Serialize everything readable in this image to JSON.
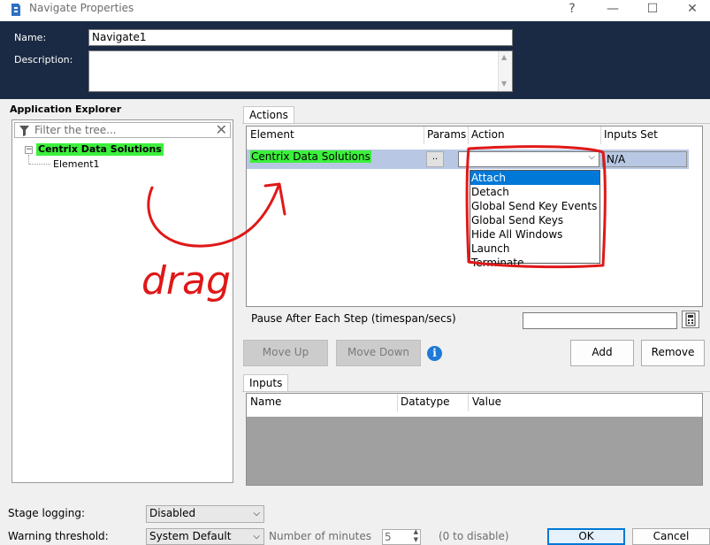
{
  "window": {
    "title": "Navigate Properties",
    "help": "?",
    "minimize": "—",
    "maximize": "☐",
    "close": "✕"
  },
  "header": {
    "name_label": "Name:",
    "name_value": "Navigate1",
    "description_label": "Description:"
  },
  "explorer": {
    "title": "Application Explorer",
    "filter_placeholder": "Filter the tree...",
    "root": "Centrix Data Solutions",
    "child": "Element1",
    "expander": "−"
  },
  "actions": {
    "tab_label": "Actions",
    "columns": [
      "Element",
      "Params",
      "Action",
      "Inputs Set"
    ],
    "row": {
      "element": "Centrix Data Solutions",
      "params": "..",
      "action": "",
      "inputs_set": "N/A"
    },
    "dropdown_items": [
      "Attach",
      "Detach",
      "Global Send Key Events",
      "Global Send Keys",
      "Hide All Windows",
      "Launch",
      "Terminate"
    ],
    "selected_index": 0,
    "pause_label": "Pause After Each Step (timespan/secs)"
  },
  "buttons": {
    "move_up": "Move Up",
    "move_down": "Move Down",
    "add": "Add",
    "remove": "Remove",
    "ok": "OK",
    "cancel": "Cancel"
  },
  "inputs": {
    "tab_label": "Inputs",
    "columns": [
      "Name",
      "Datatype",
      "Value"
    ]
  },
  "footer": {
    "stage_logging_label": "Stage logging:",
    "stage_logging_value": "Disabled",
    "warning_label": "Warning threshold:",
    "warning_value": "System Default",
    "minutes_label": "Number of minutes",
    "minutes_value": "5",
    "zero_hint": "(0 to disable)"
  },
  "annotation": {
    "text": "drag",
    "color": "#e01818"
  },
  "colors": {
    "header_bg": "#1b2a44",
    "highlight_green": "#3cf03c",
    "selection_blue": "#0078d7",
    "row_selection": "#b8c8e4"
  }
}
